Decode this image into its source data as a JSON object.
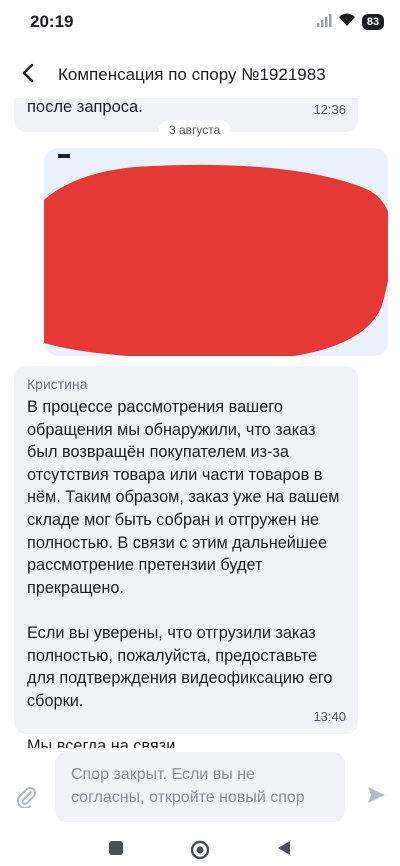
{
  "status_bar": {
    "time": "20:19",
    "battery": "83",
    "icons": [
      "signal-icon",
      "wifi-icon",
      "battery-icon"
    ]
  },
  "header": {
    "back_icon": "chevron-left-icon",
    "title": "Компенсация по спору №1921983"
  },
  "chat": {
    "previous_message": {
      "text": "после запроса.",
      "time": "12:36"
    },
    "date_separator": "3 августа",
    "redacted_message": {
      "note": "",
      "redaction_color": "#e53935"
    },
    "message": {
      "sender": "Кристина",
      "paragraphs": [
        "В процессе рассмотрения вашего обращения мы обнаружили, что заказ был возвращён покупателем из-за отсутствия товара или части товаров в нём. Таким образом, заказ уже на вашем складе мог быть собран и отгружен не полностью. В связи с этим дальнейшее рассмотрение претензии будет прекращено.",
        "Если вы уверены, что отгрузили заказ полностью, пожалуйста, предоставьте для подтверждения видеофиксацию его сборки.",
        "Мы всегда на связи."
      ],
      "time": "13:40"
    }
  },
  "input": {
    "placeholder": "Спор закрыт. Если вы не согласны, откройте новый спор",
    "attach_icon": "paperclip-icon",
    "send_icon": "send-icon"
  },
  "nav": {
    "icons": [
      "recents-icon",
      "home-icon",
      "back-triangle-icon"
    ]
  },
  "colors": {
    "bubble_incoming": "#f1f2f6",
    "bubble_outgoing": "#e9f2fc",
    "redaction": "#e53935",
    "text": "#1b1d22",
    "muted": "#8a8f99"
  }
}
